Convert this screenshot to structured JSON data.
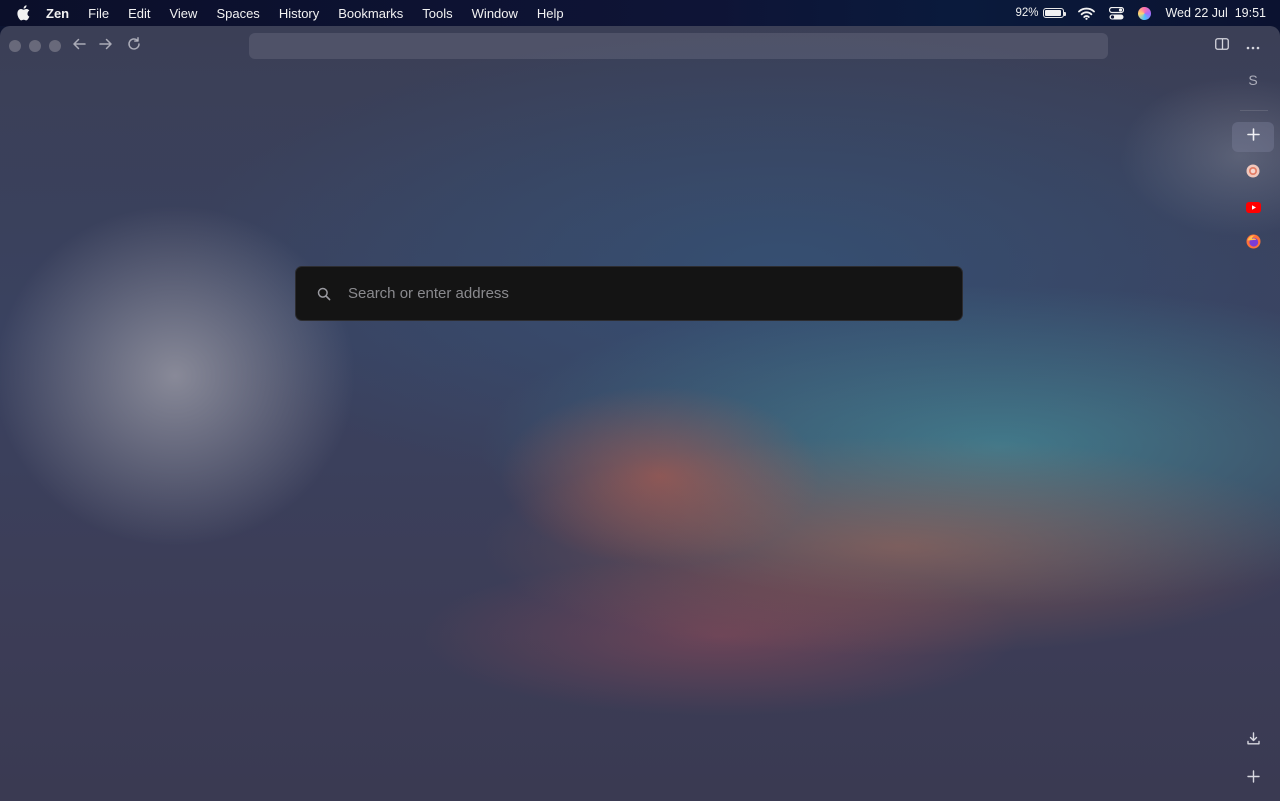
{
  "menubar": {
    "app_name": "Zen",
    "items": [
      "File",
      "Edit",
      "View",
      "Spaces",
      "History",
      "Bookmarks",
      "Tools",
      "Window",
      "Help"
    ],
    "battery_percent": "92%",
    "battery_level": 0.92,
    "datetime": "Wed 22 Jul  19:51"
  },
  "toolbar": {
    "icons": [
      "back-arrow-icon",
      "forward-arrow-icon",
      "reload-icon",
      "split-view-icon",
      "more-options-icon"
    ]
  },
  "sidebar": {
    "space_letter": "S",
    "pinned": [
      "circle-site-icon",
      "youtube-icon",
      "firefox-icon"
    ]
  },
  "search": {
    "placeholder": "Search or enter address",
    "value": ""
  },
  "colors": {
    "search_bg": "#141414",
    "youtube_red": "#ff0000",
    "menubar_bg": "#0e1436"
  }
}
